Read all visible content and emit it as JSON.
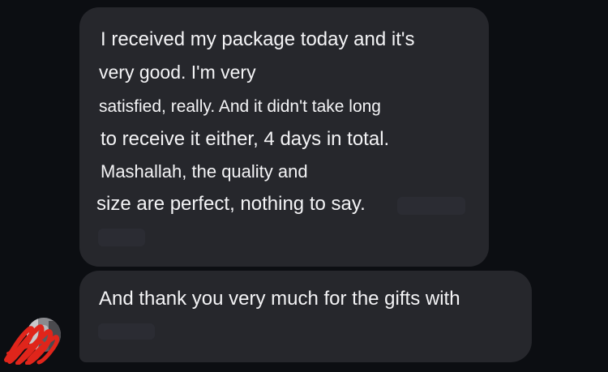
{
  "messages": [
    {
      "lines": [
        "I received my package today and it's",
        "very good. I'm very",
        "satisfied, really. And it didn't take long",
        "to receive it either, 4 days in total.",
        "Mashallah, the quality and",
        "size are perfect, nothing to say."
      ]
    },
    {
      "lines": [
        "And thank you very much for the gifts with"
      ]
    }
  ],
  "colors": {
    "background": "#0c0e12",
    "bubble": "#26272c",
    "text": "#f4f4f6",
    "scribble": "#e0251b"
  },
  "avatar": {
    "icon": "avatar-photo-icon",
    "overlay": "red-scribble-redaction"
  }
}
